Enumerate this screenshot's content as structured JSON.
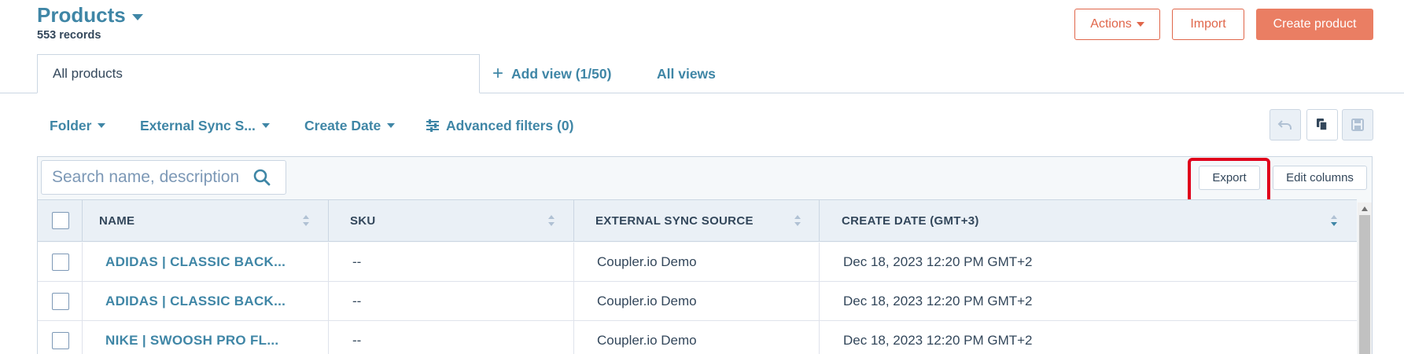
{
  "header": {
    "title": "Products",
    "records": "553 records",
    "actions_label": "Actions",
    "import_label": "Import",
    "create_label": "Create product"
  },
  "tabs": {
    "active": "All products",
    "add_view": "Add view (1/50)",
    "all_views": "All views"
  },
  "filters": {
    "folder": "Folder",
    "external_sync": "External Sync S...",
    "create_date": "Create Date",
    "advanced": "Advanced filters (0)"
  },
  "toolbar": {
    "search_placeholder": "Search name, description",
    "export_label": "Export",
    "edit_columns_label": "Edit columns"
  },
  "table": {
    "columns": [
      "NAME",
      "SKU",
      "EXTERNAL SYNC SOURCE",
      "CREATE DATE (GMT+3)"
    ],
    "rows": [
      {
        "name": "ADIDAS | CLASSIC BACK...",
        "sku": "--",
        "source": "Coupler.io Demo",
        "date": "Dec 18, 2023 12:20 PM GMT+2"
      },
      {
        "name": "ADIDAS | CLASSIC BACK...",
        "sku": "--",
        "source": "Coupler.io Demo",
        "date": "Dec 18, 2023 12:20 PM GMT+2"
      },
      {
        "name": "NIKE | SWOOSH PRO FL...",
        "sku": "--",
        "source": "Coupler.io Demo",
        "date": "Dec 18, 2023 12:20 PM GMT+2"
      }
    ]
  },
  "colors": {
    "brand_teal": "#3f86a6",
    "accent_orange": "#ea7e63",
    "highlight_red": "#e0001b"
  },
  "icons": [
    "caret-down-icon",
    "plus-icon",
    "sliders-icon",
    "undo-icon",
    "copy-icon",
    "save-icon",
    "search-icon",
    "sort-icon"
  ]
}
